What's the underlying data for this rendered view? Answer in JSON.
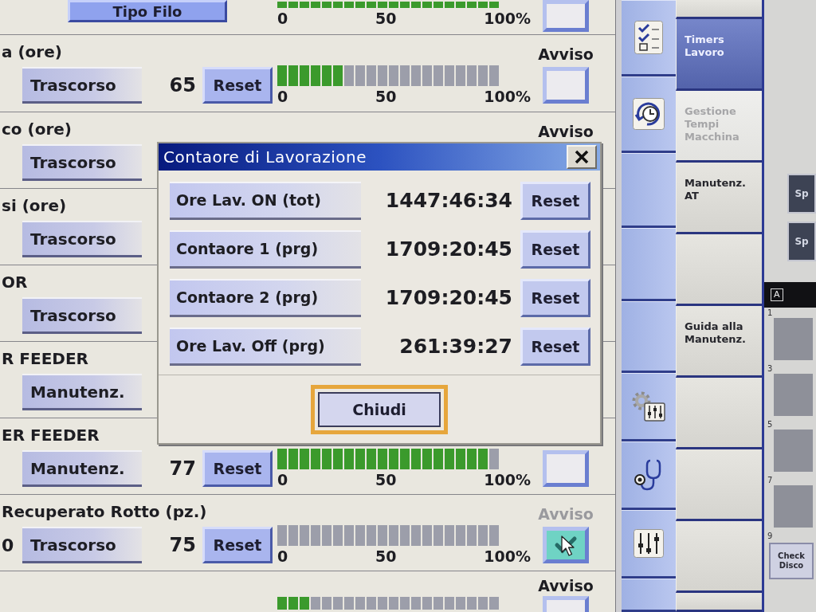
{
  "counters": {
    "rows": [
      {
        "kind": "selector",
        "button": "Tipo Filo",
        "bar": {
          "level": 1
        },
        "scale": [
          "0",
          "50",
          "100%"
        ],
        "alert": {
          "checked": false
        }
      },
      {
        "kind": "counter",
        "title": "a (ore)",
        "mode": "Trascorso",
        "value": "65",
        "reset": "Reset",
        "bar": {
          "level": 0.3
        },
        "scale": [
          "0",
          "50",
          "100%"
        ],
        "alert": {
          "label": "Avviso",
          "dimmed": false,
          "checked": false
        }
      },
      {
        "kind": "counter",
        "title": "co (ore)",
        "mode": "Trascorso",
        "alert": {
          "label": "Avviso",
          "dimmed": false
        }
      },
      {
        "kind": "counter",
        "title": "si (ore)",
        "mode": "Trascorso"
      },
      {
        "kind": "counter",
        "title": "OR",
        "mode": "Trascorso"
      },
      {
        "kind": "counter",
        "title": "R FEEDER",
        "mode": "Manutenz."
      },
      {
        "kind": "counter",
        "title": "ER FEEDER",
        "mode": "Manutenz.",
        "value": "77",
        "reset": "Reset",
        "bar": {
          "level": 0.95
        },
        "scale": [
          "0",
          "50",
          "100%"
        ],
        "alert": {
          "checked": false
        }
      },
      {
        "kind": "counter",
        "title": "Recuperato Rotto (pz.)",
        "left_value": "0",
        "mode": "Trascorso",
        "value": "75",
        "reset": "Reset",
        "bar": {
          "level": 0
        },
        "scale": [
          "0",
          "50",
          "100%"
        ],
        "alert": {
          "label": "Avviso",
          "dimmed": true,
          "checked": true
        }
      },
      {
        "kind": "counter",
        "bar": {
          "level": 0.15
        },
        "alert": {
          "label": "Avviso",
          "dimmed": false,
          "checked": false
        }
      }
    ]
  },
  "dialog": {
    "title": "Contaore di Lavorazione",
    "rows": [
      {
        "label": "Ore Lav. ON (tot)",
        "value": "1447:46:34",
        "button": "Reset"
      },
      {
        "label": "Contaore 1 (prg)",
        "value": "1709:20:45",
        "button": "Reset"
      },
      {
        "label": "Contaore 2 (prg)",
        "value": "1709:20:45",
        "button": "Reset"
      },
      {
        "label": "Ore Lav. Off (prg)",
        "value": "261:39:27",
        "button": "Reset"
      }
    ],
    "close_button": "Chiudi"
  },
  "nav_tabs": [
    {
      "selected": false,
      "disabled": false
    },
    {
      "label": "Timers Lavoro",
      "selected": true,
      "disabled": false
    },
    {
      "label": "Gestione Tempi Macchina",
      "selected": false,
      "disabled": true
    },
    {
      "label": "Manutenz. AT",
      "selected": false,
      "disabled": false
    },
    {
      "selected": false,
      "disabled": false
    },
    {
      "label": "Guida alla Manutenz.",
      "selected": false,
      "disabled": false
    },
    {
      "selected": false,
      "disabled": false
    },
    {
      "selected": false,
      "disabled": false
    },
    {
      "selected": false,
      "disabled": false
    },
    {
      "selected": false,
      "disabled": false
    }
  ],
  "side_panel": {
    "buttons": [
      {
        "label": "Sp"
      },
      {
        "label": "Sp"
      }
    ],
    "header_badge": "A",
    "rows": [
      {
        "number": "1"
      },
      {
        "number": "3"
      },
      {
        "number": "5"
      },
      {
        "number": "7"
      },
      {
        "number": "9",
        "button": "Check Disco"
      }
    ]
  }
}
